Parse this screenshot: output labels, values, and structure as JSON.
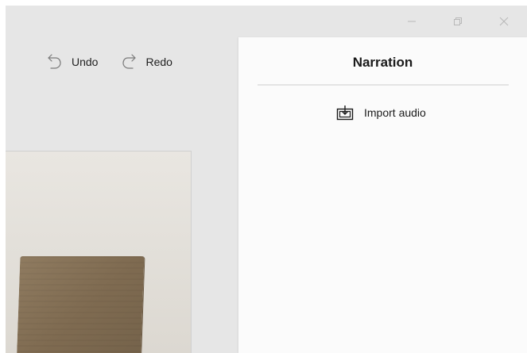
{
  "window": {
    "controls": [
      {
        "name": "minimize-button",
        "icon": "minimize-icon"
      },
      {
        "name": "restore-button",
        "icon": "restore-icon"
      },
      {
        "name": "close-button",
        "icon": "close-icon"
      }
    ]
  },
  "toolbar": {
    "undo_label": "Undo",
    "undo_icon": "undo-icon",
    "redo_label": "Redo",
    "redo_icon": "redo-icon"
  },
  "narration_panel": {
    "title": "Narration",
    "import_label": "Import audio",
    "import_icon": "import-audio-icon"
  },
  "colors": {
    "app_background": "#e6e6e6",
    "panel_background": "#fbfbfb",
    "text": "#1a1a1a",
    "icon_muted": "#7a7a7a"
  }
}
